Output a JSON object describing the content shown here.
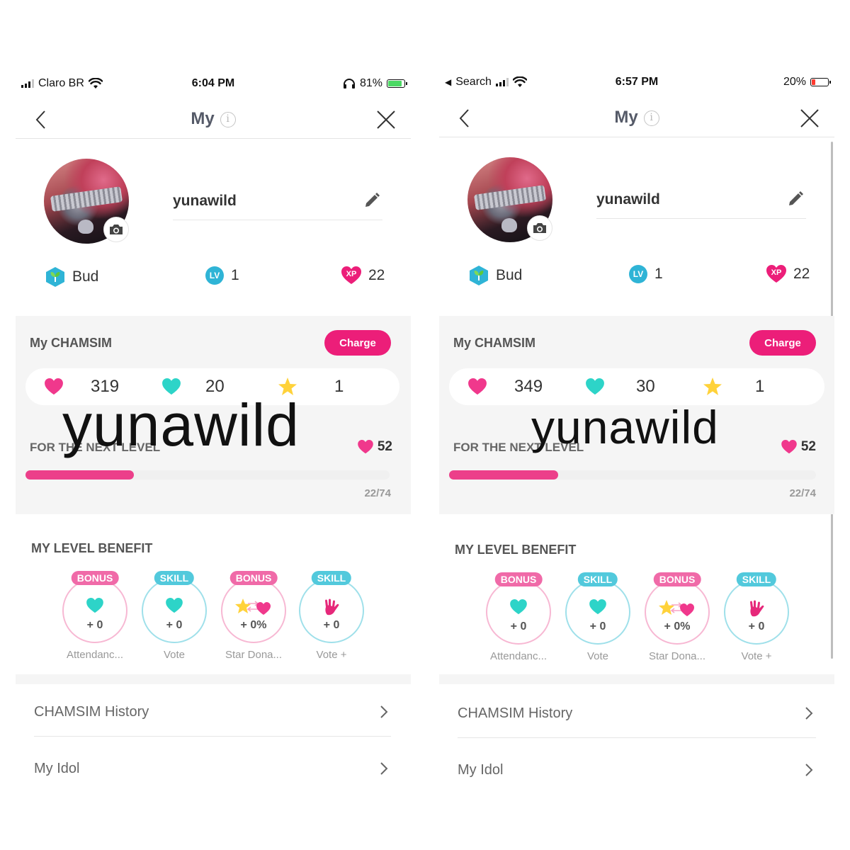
{
  "colors": {
    "accent_pink": "#ec1e79",
    "progress_pink": "#ec3f8a",
    "teal": "#2fb4d6",
    "bonus_pink": "#f06aa8",
    "skill_teal": "#52c9dc"
  },
  "screens": [
    {
      "status": {
        "carrier": "Claro BR",
        "time": "6:04 PM",
        "battery": "81%",
        "battery_level": 0.81
      },
      "nav": {
        "title": "My",
        "info": "i"
      },
      "profile": {
        "username": "yunawild"
      },
      "stats": {
        "grade": "Bud",
        "level_badge": "LV",
        "level": "1",
        "xp_badge": "XP",
        "xp": "22"
      },
      "chamsim": {
        "title": "My CHAMSIM",
        "charge_label": "Charge",
        "pink_hearts": "319",
        "teal_hearts": "20",
        "stars": "1"
      },
      "next_level": {
        "label": "FOR THE NEXT LEVEL",
        "hearts": "52",
        "progress_text": "22/74",
        "progress": 0.297
      },
      "benefits": {
        "title": "MY LEVEL BENEFIT",
        "items": [
          {
            "tag": "BONUS",
            "value": "+ 0",
            "caption": "Attendanc...",
            "icon": "teal-heart-icon"
          },
          {
            "tag": "SKILL",
            "value": "+ 0",
            "caption": "Vote",
            "icon": "teal-heart-icon"
          },
          {
            "tag": "BONUS",
            "value": "+ 0%",
            "caption": "Star Dona...",
            "icon": "star-to-heart-icon"
          },
          {
            "tag": "SKILL",
            "value": "+ 0",
            "caption": "Vote +",
            "icon": "rock-hand-icon"
          }
        ]
      },
      "menu": [
        {
          "label": "CHAMSIM History"
        },
        {
          "label": "My Idol"
        }
      ],
      "overlay_text": "yunawild"
    },
    {
      "status": {
        "carrier": "Search",
        "time": "6:57 PM",
        "battery": "20%",
        "battery_level": 0.2
      },
      "nav": {
        "title": "My",
        "info": "i"
      },
      "profile": {
        "username": "yunawild"
      },
      "stats": {
        "grade": "Bud",
        "level_badge": "LV",
        "level": "1",
        "xp_badge": "XP",
        "xp": "22"
      },
      "chamsim": {
        "title": "My CHAMSIM",
        "charge_label": "Charge",
        "pink_hearts": "349",
        "teal_hearts": "30",
        "stars": "1"
      },
      "next_level": {
        "label": "FOR THE NEXT LEVEL",
        "hearts": "52",
        "progress_text": "22/74",
        "progress": 0.297
      },
      "benefits": {
        "title": "MY LEVEL BENEFIT",
        "items": [
          {
            "tag": "BONUS",
            "value": "+ 0",
            "caption": "Attendanc...",
            "icon": "teal-heart-icon"
          },
          {
            "tag": "SKILL",
            "value": "+ 0",
            "caption": "Vote",
            "icon": "teal-heart-icon"
          },
          {
            "tag": "BONUS",
            "value": "+ 0%",
            "caption": "Star Dona...",
            "icon": "star-to-heart-icon"
          },
          {
            "tag": "SKILL",
            "value": "+ 0",
            "caption": "Vote +",
            "icon": "rock-hand-icon"
          }
        ]
      },
      "menu": [
        {
          "label": "CHAMSIM History"
        },
        {
          "label": "My Idol"
        }
      ],
      "overlay_text": "yunawild"
    }
  ]
}
